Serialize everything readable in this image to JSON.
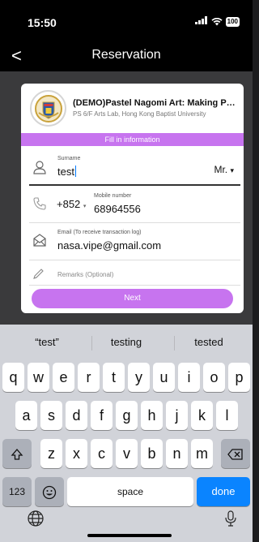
{
  "status": {
    "time": "15:50",
    "battery": "100"
  },
  "nav": {
    "back": "<",
    "title": "Reservation"
  },
  "event": {
    "name": "(DEMO)Pastel Nagomi Art: Making Pastel Art",
    "location": "PS 6/F Arts Lab, Hong Kong Baptist University"
  },
  "form": {
    "section_title": "Fill in information",
    "surname": {
      "label": "Surname",
      "value": "test",
      "title": "Mr.",
      "title_arrow": "▾"
    },
    "mobile": {
      "country_code": "+852",
      "arrow": "▾",
      "label": "Mobile number",
      "value": "68964556"
    },
    "email": {
      "label": "Email (To receive transaction log)",
      "value": "nasa.vipe@gmail.com"
    },
    "remarks": {
      "placeholder": "Remarks (Optional)"
    },
    "next_label": "Next"
  },
  "keyboard": {
    "suggestions": [
      "“test”",
      "testing",
      "tested"
    ],
    "row1": [
      "q",
      "w",
      "e",
      "r",
      "t",
      "y",
      "u",
      "i",
      "o",
      "p"
    ],
    "row2": [
      "a",
      "s",
      "d",
      "f",
      "g",
      "h",
      "j",
      "k",
      "l"
    ],
    "row3": [
      "z",
      "x",
      "c",
      "v",
      "b",
      "n",
      "m"
    ],
    "numbers": "123",
    "space": "space",
    "done": "done"
  },
  "colors": {
    "accent": "#c774ef",
    "done_blue": "#0a84ff",
    "keyboard_bg": "#d1d3d9"
  }
}
